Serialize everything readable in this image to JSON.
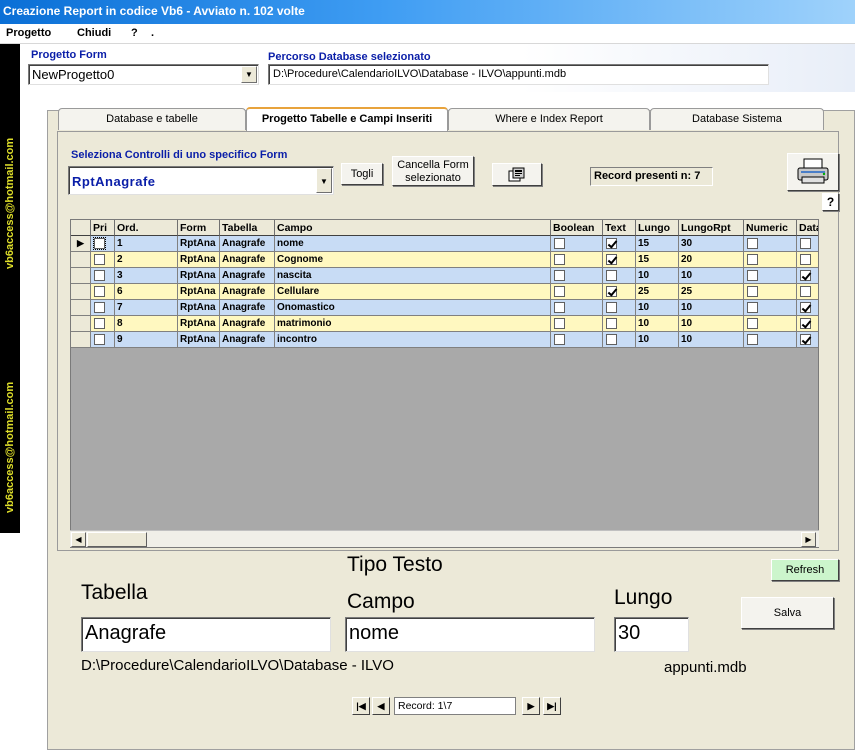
{
  "window": {
    "title": "Creazione Report in codice Vb6 - Avviato n. 102 volte"
  },
  "menu": {
    "items": [
      "Progetto",
      "Chiudi",
      "?",
      "."
    ]
  },
  "banner": {
    "text1": "vb6access@hotmail.com",
    "text2": "vb6access@hotmail.com"
  },
  "header": {
    "project_label": "Progetto Form",
    "project_value": "NewProgetto0",
    "db_path_label": "Percorso Database selezionato",
    "db_path_value": "D:\\Procedure\\CalendarioILVO\\Database - ILVO\\appunti.mdb"
  },
  "tabs": [
    {
      "label": "Database e tabelle"
    },
    {
      "label": "Progetto Tabelle e Campi Inseriti"
    },
    {
      "label": "Where e Index Report"
    },
    {
      "label": "Database Sistema"
    }
  ],
  "controls": {
    "select_form_label": "Seleziona Controlli di uno specifico Form",
    "form_combo_value": "RptAnagrafe",
    "togli_label": "Togli",
    "cancella_label_1": "Cancella Form",
    "cancella_label_2": "selezionato",
    "record_count": "Record presenti n: 7",
    "help_glyph": "?"
  },
  "grid": {
    "columns": [
      "",
      "Pri",
      "Ord.",
      "Form",
      "Tabella",
      "Campo",
      "Boolean",
      "Text",
      "Lungo",
      "LungoRpt",
      "Numeric",
      "Data"
    ],
    "rows": [
      {
        "ord": "1",
        "form": "RptAna",
        "tabella": "Anagrafe",
        "campo": "nome",
        "boolean": false,
        "text": true,
        "lungo": "15",
        "lungorpt": "30",
        "numeric": false,
        "data": false
      },
      {
        "ord": "2",
        "form": "RptAna",
        "tabella": "Anagrafe",
        "campo": "Cognome",
        "boolean": false,
        "text": true,
        "lungo": "15",
        "lungorpt": "20",
        "numeric": false,
        "data": false
      },
      {
        "ord": "3",
        "form": "RptAna",
        "tabella": "Anagrafe",
        "campo": "nascita",
        "boolean": false,
        "text": false,
        "lungo": "10",
        "lungorpt": "10",
        "numeric": false,
        "data": true
      },
      {
        "ord": "6",
        "form": "RptAna",
        "tabella": "Anagrafe",
        "campo": "Cellulare",
        "boolean": false,
        "text": true,
        "lungo": "25",
        "lungorpt": "25",
        "numeric": false,
        "data": false
      },
      {
        "ord": "7",
        "form": "RptAna",
        "tabella": "Anagrafe",
        "campo": "Onomastico",
        "boolean": false,
        "text": false,
        "lungo": "10",
        "lungorpt": "10",
        "numeric": false,
        "data": true
      },
      {
        "ord": "8",
        "form": "RptAna",
        "tabella": "Anagrafe",
        "campo": "matrimonio",
        "boolean": false,
        "text": false,
        "lungo": "10",
        "lungorpt": "10",
        "numeric": false,
        "data": true
      },
      {
        "ord": "9",
        "form": "RptAna",
        "tabella": "Anagrafe",
        "campo": "incontro",
        "boolean": false,
        "text": false,
        "lungo": "10",
        "lungorpt": "10",
        "numeric": false,
        "data": true
      }
    ]
  },
  "details": {
    "refresh_label": "Refresh",
    "tipo_testo_label": "Tipo Testo",
    "tabella_label": "Tabella",
    "campo_label": "Campo",
    "lungo_label": "Lungo",
    "salva_label": "Salva",
    "tabella_value": "Anagrafe",
    "campo_value": "nome",
    "lungo_value": "30",
    "path_text": "D:\\Procedure\\CalendarioILVO\\Database - ILVO",
    "file_text": "appunti.mdb"
  },
  "navigator": {
    "record_text": "Record: 1\\7"
  }
}
